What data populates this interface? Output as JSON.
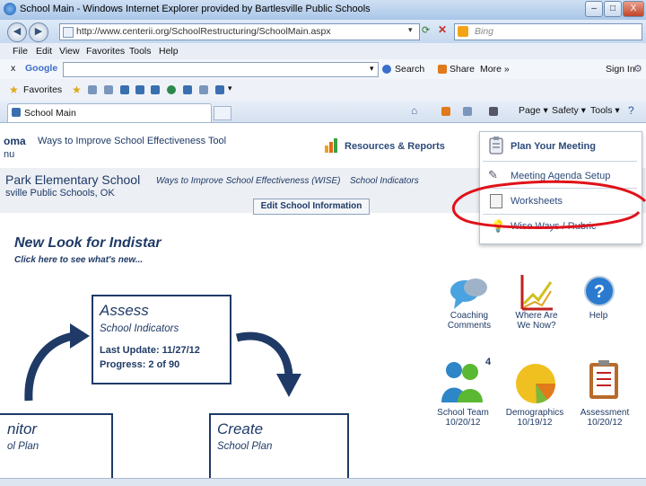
{
  "window": {
    "title": "School Main - Windows Internet Explorer provided by Bartlesville Public Schools",
    "minimize": "–",
    "maximize": "□",
    "close": "X"
  },
  "address": {
    "url": "http://www.centerii.org/SchoolRestructuring/SchoolMain.aspx",
    "search_placeholder": "Bing"
  },
  "menu": [
    "File",
    "Edit",
    "View",
    "Favorites",
    "Tools",
    "Help"
  ],
  "google_bar": {
    "close": "x",
    "logo": "Google",
    "search": "Search",
    "share": "Share",
    "more": "More »",
    "sign_in": "Sign In"
  },
  "favorites": {
    "label": "Favorites"
  },
  "tab": {
    "label": "School Main"
  },
  "command_bar": {
    "page": "Page ▾",
    "safety": "Safety ▾",
    "tools": "Tools ▾"
  },
  "header": {
    "state_fragment": "oma",
    "ways_title": "Ways to Improve School Effectiveness Tool",
    "nu_fragment": "nu",
    "resources": "Resources & Reports",
    "school_name": "Park Elementary School",
    "wise_link": "Ways to Improve School Effectiveness (WISE)",
    "indicators_link": "School Indicators",
    "district": "sville Public Schools, OK",
    "edit_button": "Edit School Information"
  },
  "dropdown": {
    "heading": "Plan Your Meeting",
    "items": [
      "Meeting Agenda Setup",
      "Worksheets",
      "Wise Ways / Rubric"
    ],
    "highlight_color": "#e0121a"
  },
  "main": {
    "new_look": "New Look for Indistar",
    "click_here": "Click here to see what's new...",
    "assess": {
      "title": "Assess",
      "subtitle": "School Indicators",
      "last_update": "Last Update: 11/27/12",
      "progress": "Progress: 2 of 90"
    },
    "monitor": {
      "title": "nitor",
      "subtitle": "ol Plan"
    },
    "create": {
      "title": "Create",
      "subtitle": "School Plan"
    }
  },
  "icons": [
    {
      "name": "coaching-comments",
      "label1": "Coaching",
      "label2": "Comments"
    },
    {
      "name": "where-are-we-now",
      "label1": "Where Are",
      "label2": "We Now?"
    },
    {
      "name": "help",
      "label1": "Help",
      "label2": ""
    },
    {
      "name": "school-team",
      "label1": "School Team",
      "label2": "10/20/12",
      "badge": "4"
    },
    {
      "name": "demographics",
      "label1": "Demographics",
      "label2": "10/19/12"
    },
    {
      "name": "assessment",
      "label1": "Assessment",
      "label2": "10/20/12"
    }
  ],
  "colors": {
    "navy": "#1f3a66",
    "accent_green": "#4caf50"
  }
}
